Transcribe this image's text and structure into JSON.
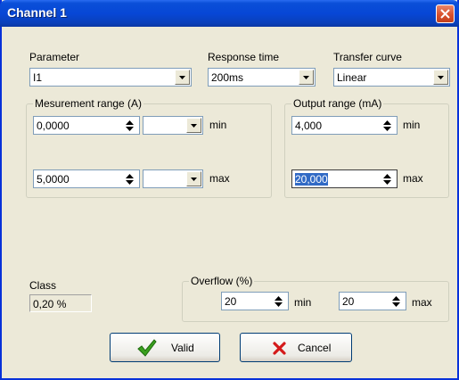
{
  "window": {
    "title": "Channel 1"
  },
  "parameter": {
    "label": "Parameter",
    "value": "I1"
  },
  "response_time": {
    "label": "Response time",
    "value": "200ms"
  },
  "transfer_curve": {
    "label": "Transfer curve",
    "value": "Linear"
  },
  "measurement_range": {
    "label": "Mesurement range (A)",
    "min": {
      "value": "0,0000",
      "unit": "",
      "suffix": "min"
    },
    "max": {
      "value": "5,0000",
      "unit": "",
      "suffix": "max"
    }
  },
  "output_range": {
    "label": "Output range (mA)",
    "min": {
      "value": "4,000",
      "suffix": "min"
    },
    "max": {
      "value": "20,000",
      "suffix": "max"
    }
  },
  "class": {
    "label": "Class",
    "value": "0,20 %"
  },
  "overflow": {
    "label": "Overflow (%)",
    "min": {
      "value": "20",
      "suffix": "min"
    },
    "max": {
      "value": "20",
      "suffix": "max"
    }
  },
  "buttons": {
    "valid": "Valid",
    "cancel": "Cancel"
  },
  "icons": {
    "close": "close-icon",
    "valid": "checkmark-icon",
    "cancel": "x-icon"
  },
  "colors": {
    "titlebar": "#0747d6",
    "dialog": "#ece9d8",
    "close": "#d9512d",
    "selection": "#316ac5"
  }
}
